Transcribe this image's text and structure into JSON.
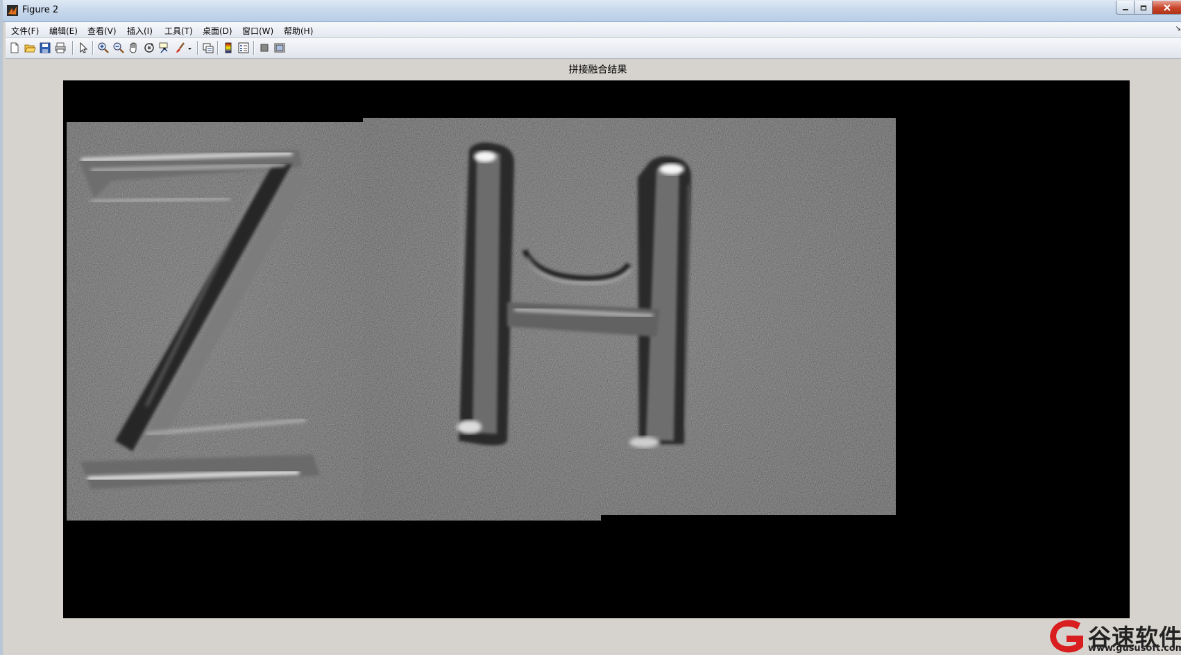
{
  "window": {
    "title": "Figure 2"
  },
  "menubar": {
    "items": [
      {
        "label": "文件(F)"
      },
      {
        "label": "编辑(E)"
      },
      {
        "label": "查看(V)"
      },
      {
        "label": "插入(I)"
      },
      {
        "label": "工具(T)"
      },
      {
        "label": "桌面(D)"
      },
      {
        "label": "窗口(W)"
      },
      {
        "label": "帮助(H)"
      }
    ]
  },
  "toolbar": {
    "buttons": [
      {
        "icon": "new-figure-icon"
      },
      {
        "icon": "open-file-icon"
      },
      {
        "icon": "save-icon"
      },
      {
        "icon": "print-icon"
      },
      {
        "icon": "edit-plot-arrow-icon"
      },
      {
        "icon": "zoom-in-icon"
      },
      {
        "icon": "zoom-out-icon"
      },
      {
        "icon": "pan-hand-icon"
      },
      {
        "icon": "rotate-3d-icon"
      },
      {
        "icon": "data-cursor-icon"
      },
      {
        "icon": "brush-icon"
      },
      {
        "icon": "link-plot-icon"
      },
      {
        "icon": "insert-colorbar-icon"
      },
      {
        "icon": "insert-legend-icon"
      },
      {
        "icon": "hide-plot-tools-icon"
      },
      {
        "icon": "show-plot-tools-icon"
      }
    ]
  },
  "figure": {
    "title": "拼接融合结果",
    "image_content": "ZH"
  },
  "watermark": {
    "brand": "谷速软件",
    "url": "www.gususoft.com",
    "accent_color": "#d81e1e"
  }
}
